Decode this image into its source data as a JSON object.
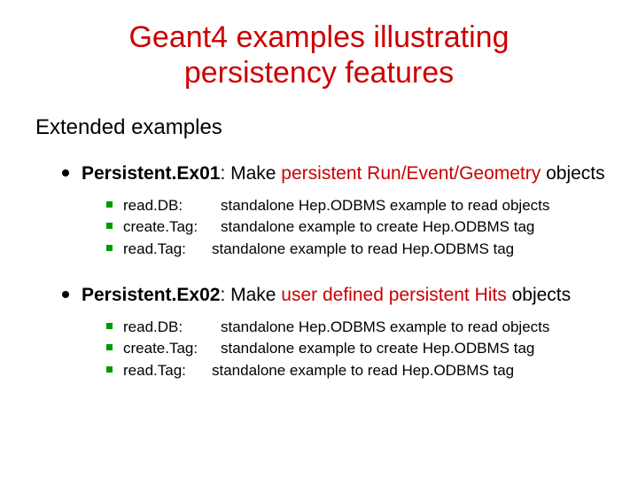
{
  "title_line1": "Geant4 examples illustrating",
  "title_line2": "persistency features",
  "subtitle": "Extended examples",
  "items": [
    {
      "name_prefix": "Persistent.Ex01",
      "desc_a": ":  Make ",
      "desc_red": "persistent Run/Event/Geometry",
      "desc_b": " objects",
      "sub": [
        {
          "label": "read.DB:",
          "text": "standalone Hep.ODBMS example to read objects"
        },
        {
          "label": "create.Tag:",
          "text": "standalone example to create Hep.ODBMS tag"
        },
        {
          "label": "read.Tag:",
          "text": "standalone example to  read   Hep.ODBMS tag"
        }
      ]
    },
    {
      "name_prefix": "Persistent.Ex02",
      "desc_a": ":  Make ",
      "desc_red": "user defined persistent Hits",
      "desc_b": " objects",
      "sub": [
        {
          "label": "read.DB:",
          "text": "standalone Hep.ODBMS example to read objects"
        },
        {
          "label": "create.Tag:",
          "text": "standalone example to create Hep.ODBMS tag"
        },
        {
          "label": "read.Tag:",
          "text": "standalone example to  read   Hep.ODBMS tag"
        }
      ]
    }
  ]
}
